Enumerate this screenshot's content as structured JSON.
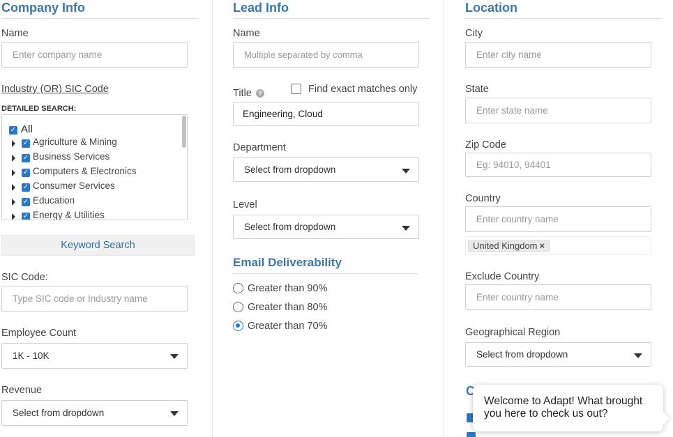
{
  "company": {
    "title": "Company Info",
    "name_label": "Name",
    "name_placeholder": "Enter company name",
    "industry_link": "Industry (OR) SIC Code",
    "detailed_search": "DETAILED SEARCH:",
    "tree_items": [
      "All",
      "Agriculture & Mining",
      "Business Services",
      "Computers & Electronics",
      "Consumer Services",
      "Education",
      "Energy & Utilities"
    ],
    "keyword_button": "Keyword Search",
    "sic_label": "SIC Code:",
    "sic_placeholder": "Type SIC code or Industry name",
    "employee_label": "Employee Count",
    "employee_value": "1K - 10K",
    "revenue_label": "Revenue",
    "revenue_value": "Select from dropdown"
  },
  "lead": {
    "title": "Lead Info",
    "name_label": "Name",
    "name_placeholder": "Multiple separated by comma",
    "title_label": "Title",
    "help_icon": "?",
    "exact_label": "Find exact matches only",
    "title_value": "Engineering, Cloud",
    "department_label": "Department",
    "department_value": "Select from dropdown",
    "level_label": "Level",
    "level_value": "Select from dropdown"
  },
  "email": {
    "title": "Email Deliverability",
    "options": [
      "Greater than 90%",
      "Greater than 80%",
      "Greater than 70%"
    ],
    "selected_index": 2
  },
  "location": {
    "title": "Location",
    "city_label": "City",
    "city_placeholder": "Enter city name",
    "state_label": "State",
    "state_placeholder": "Enter state name",
    "zip_label": "Zip Code",
    "zip_placeholder": "Eg: 94010, 94401",
    "country_label": "Country",
    "country_placeholder": "Enter country name",
    "country_tag": "United Kingdom",
    "tag_remove": "×",
    "exclude_label": "Exclude Country",
    "exclude_placeholder": "Enter country name",
    "region_label": "Geographical Region",
    "region_value": "Select from dropdown"
  },
  "chat": {
    "message": "Welcome to Adapt! What brought you here to check us out?"
  },
  "colors": {
    "accent": "#3b78a8",
    "checkbox": "#2a78c5"
  }
}
